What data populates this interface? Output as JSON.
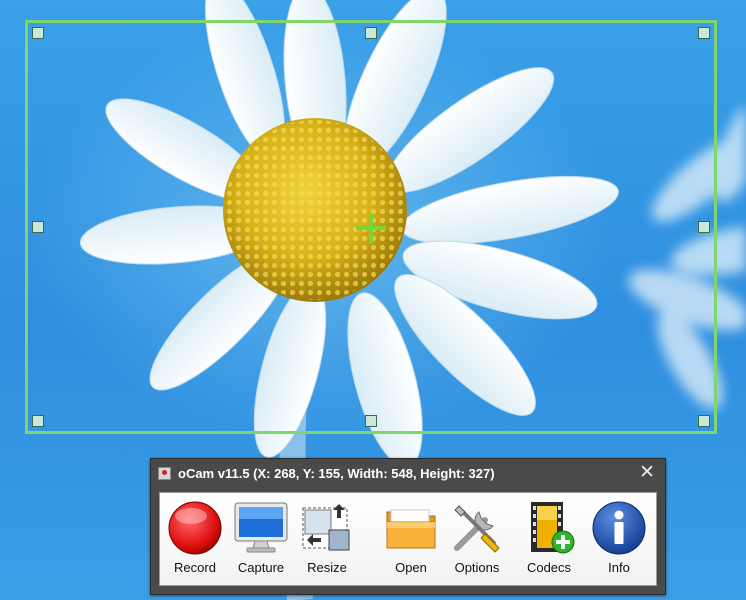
{
  "window": {
    "title": "oCam v11.5 (X: 268, Y: 155, Width: 548, Height: 327)",
    "close_symbol": "✕"
  },
  "toolbar": {
    "buttons": [
      {
        "label": "Record",
        "icon": "record-icon"
      },
      {
        "label": "Capture",
        "icon": "monitor-icon"
      },
      {
        "label": "Resize",
        "icon": "resize-icon"
      },
      {
        "label": "Open",
        "icon": "folder-icon"
      },
      {
        "label": "Options",
        "icon": "tools-icon"
      },
      {
        "label": "Codecs",
        "icon": "film-add-icon"
      },
      {
        "label": "Info",
        "icon": "info-icon"
      }
    ]
  },
  "colors": {
    "selection_border": "#7fd66a",
    "crosshair": "#76d63a",
    "desktop_blue": "#3aa0e8"
  }
}
